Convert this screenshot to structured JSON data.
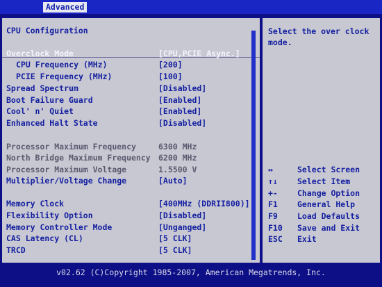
{
  "menu": {
    "active_tab": "Advanced"
  },
  "panel": {
    "title": "CPU Configuration",
    "rows": [
      {
        "label": "Overclock Mode",
        "value": "[CPU,PCIE Async.]"
      },
      {
        "label": "CPU Frequency (MHz)",
        "value": "[200]"
      },
      {
        "label": "PCIE Frequency (MHz)",
        "value": "[100]"
      },
      {
        "label": "Spread Spectrum",
        "value": "[Disabled]"
      },
      {
        "label": "Boot Failure Guard",
        "value": "[Enabled]"
      },
      {
        "label": "Cool' n' Quiet",
        "value": "[Enabled]"
      },
      {
        "label": "Enhanced Halt State",
        "value": "[Disabled]"
      },
      {
        "label": "Processor Maximum Frequency",
        "value": "6300 MHz"
      },
      {
        "label": "North Bridge Maximum Frequency",
        "value": "6200 MHz"
      },
      {
        "label": "Processor Maximum Voltage",
        "value": "1.5500 V"
      },
      {
        "label": "Multiplier/Voltage Change",
        "value": "[Auto]"
      },
      {
        "label": "Memory Clock",
        "value": "[400MHz (DDRII800)]"
      },
      {
        "label": "Flexibility Option",
        "value": "[Disabled]"
      },
      {
        "label": "Memory Controller Mode",
        "value": "[Unganged]"
      },
      {
        "label": "CAS Latency (CL)",
        "value": "[5 CLK]"
      },
      {
        "label": "TRCD",
        "value": "[5 CLK]"
      }
    ]
  },
  "help": {
    "text": "Select the over clock mode.",
    "keys": [
      {
        "key": "↔",
        "desc": "Select Screen"
      },
      {
        "key": "↑↓",
        "desc": "Select Item"
      },
      {
        "key": "+-",
        "desc": "Change Option"
      },
      {
        "key": "F1",
        "desc": "General Help"
      },
      {
        "key": "F9",
        "desc": "Load Defaults"
      },
      {
        "key": "F10",
        "desc": "Save and Exit"
      },
      {
        "key": "ESC",
        "desc": "Exit"
      }
    ]
  },
  "footer": {
    "copyright": "v02.62 (C)Copyright 1985-2007, American Megatrends, Inc."
  },
  "colors": {
    "background": "#0d0f86",
    "panel": "#c8c8d2",
    "highlight": "#f4f4ff",
    "text": "#1420a0"
  }
}
